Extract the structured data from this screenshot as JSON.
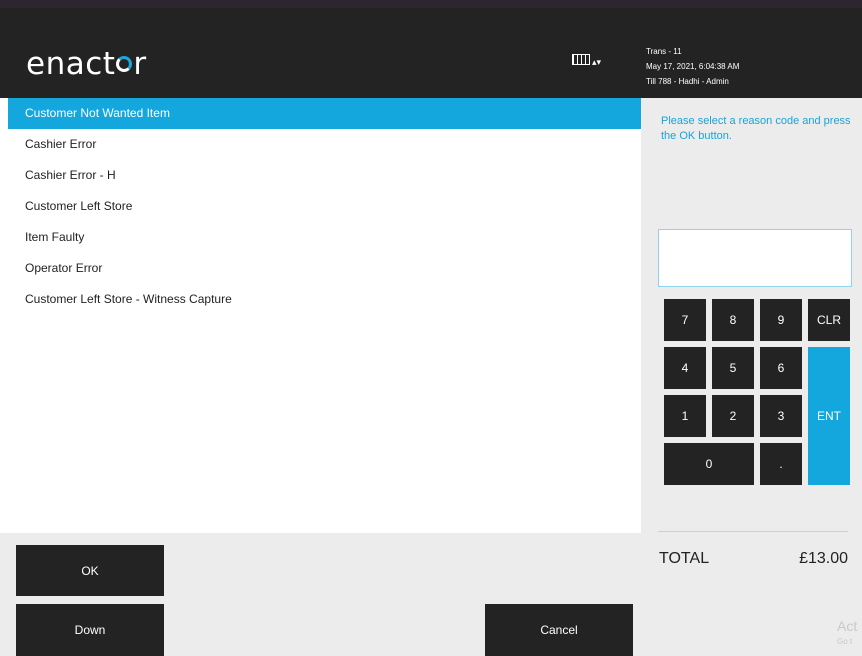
{
  "header": {
    "logo_pre": "enact",
    "logo_post": "r",
    "trans": "Trans - 11",
    "datetime": "May 17, 2021, 6:04:38 AM",
    "till": "Till 788 - Hadhi - Admin",
    "keyboard_icon": "keyboard-icon"
  },
  "reasons": {
    "selected_index": 0,
    "items": [
      "Customer Not Wanted Item",
      "Cashier Error",
      "Cashier Error - H",
      "Customer Left Store",
      "Item Faulty",
      "Operator Error",
      "Customer Left Store - Witness Capture"
    ]
  },
  "panel": {
    "prompt": "Please select a reason code and press the OK button.",
    "entry_value": ""
  },
  "keypad": {
    "k7": "7",
    "k8": "8",
    "k9": "9",
    "clr": "CLR",
    "k4": "4",
    "k5": "5",
    "k6": "6",
    "k1": "1",
    "k2": "2",
    "k3": "3",
    "ent": "ENT",
    "k0": "0",
    "dot": "."
  },
  "totals": {
    "label": "TOTAL",
    "value": "£13.00"
  },
  "watermark": {
    "line1": "Act",
    "line2": "Go t"
  },
  "buttons": {
    "ok": "OK",
    "down": "Down",
    "cancel": "Cancel"
  },
  "colors": {
    "accent": "#13a7dd",
    "header": "#232323",
    "panel": "#ececec"
  }
}
